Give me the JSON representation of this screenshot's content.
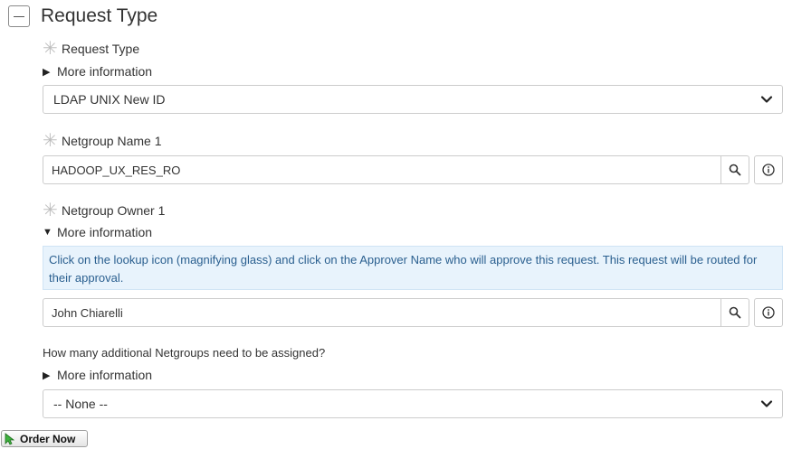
{
  "section": {
    "title": "Request Type"
  },
  "fields": {
    "request_type": {
      "label": "Request Type",
      "more_info": "More information",
      "value": "LDAP UNIX New ID"
    },
    "netgroup_name": {
      "label": "Netgroup Name 1",
      "value": "HADOOP_UX_RES_RO"
    },
    "netgroup_owner": {
      "label": "Netgroup Owner 1",
      "more_info": "More information",
      "help_text": "Click on the lookup icon (magnifying glass) and click on the Approver Name who will approve this request. This request will be routed for their approval.",
      "value": "John Chiarelli"
    },
    "additional_netgroups": {
      "question": "How many additional Netgroups need to be assigned?",
      "more_info": "More information",
      "value": "-- None --"
    }
  },
  "actions": {
    "order_now": "Order Now"
  },
  "colors": {
    "help_bg": "#e8f3fc",
    "help_text": "#2a5f8f",
    "required_asterisk": "#bfbfbf",
    "border": "#cccccc"
  },
  "icons": {
    "section_toggle": "collapse-minus-icon",
    "lookup": "magnifying-glass-icon",
    "info": "info-circle-icon",
    "dropdown": "chevron-down-icon",
    "required": "asterisk-icon",
    "expand": "triangle-right-icon",
    "collapse": "triangle-down-icon",
    "cursor": "pointer-cursor-icon"
  }
}
